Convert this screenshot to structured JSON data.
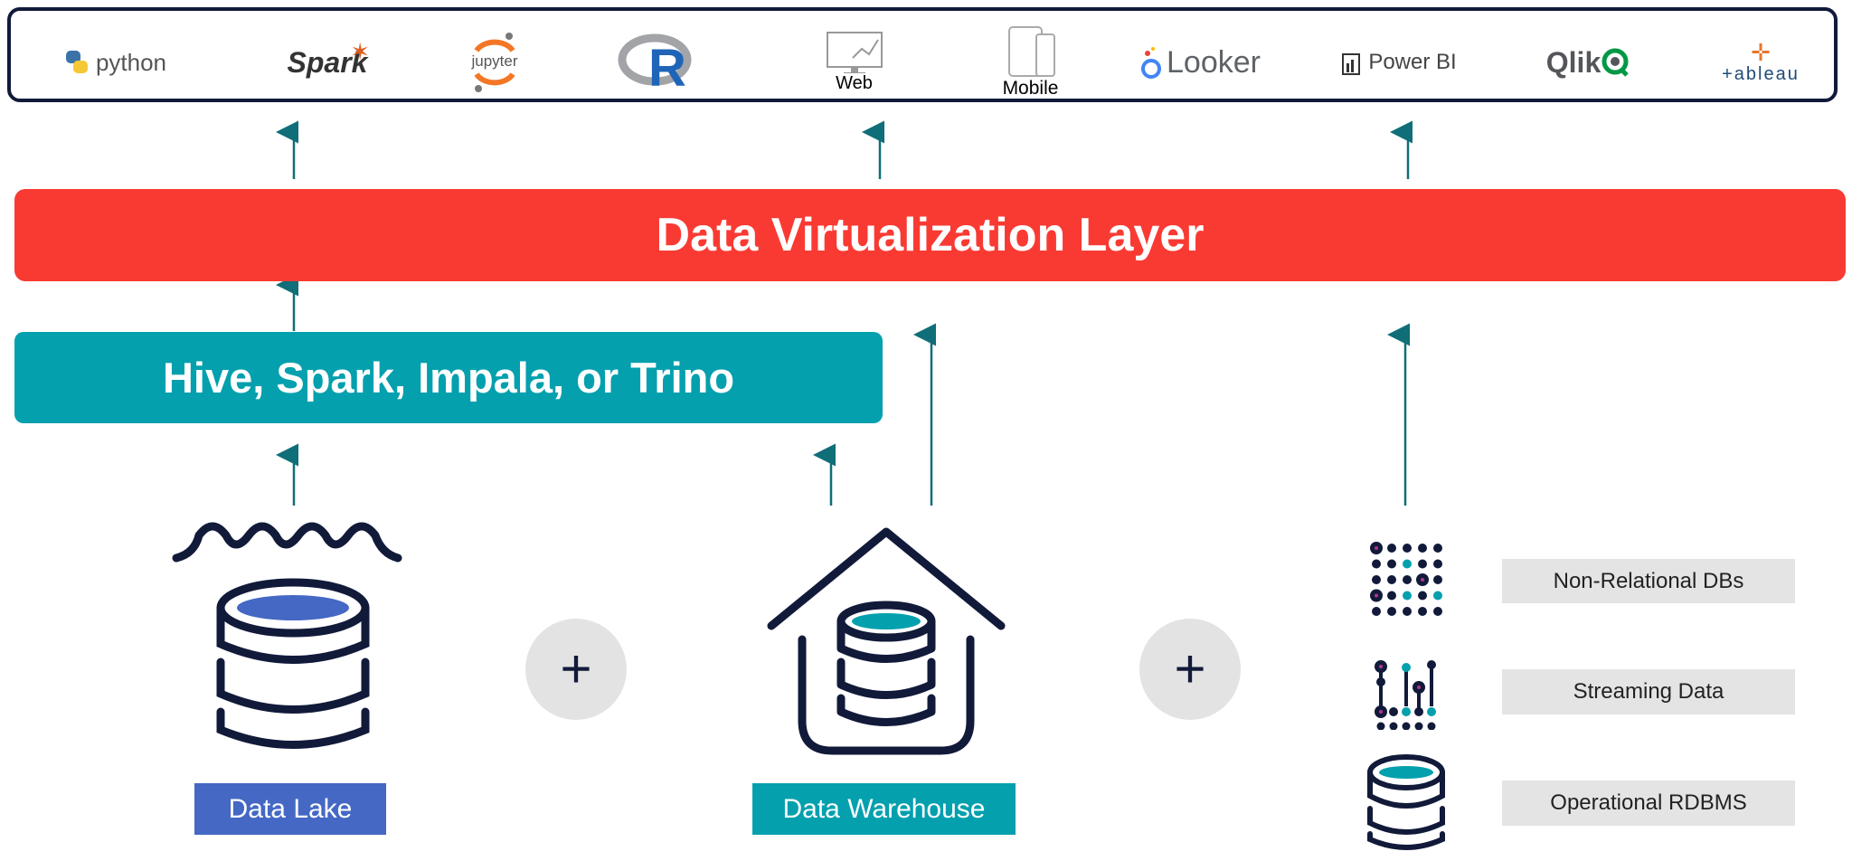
{
  "tools_bar": {
    "logos": [
      {
        "name": "python",
        "text": "python"
      },
      {
        "name": "spark",
        "text": "Spark"
      },
      {
        "name": "jupyter",
        "text": "jupyter"
      },
      {
        "name": "r",
        "text": "R"
      },
      {
        "name": "web",
        "text": "Web"
      },
      {
        "name": "mobile",
        "text": "Mobile"
      },
      {
        "name": "looker",
        "text": "Looker"
      },
      {
        "name": "power-bi",
        "text": "Power BI"
      },
      {
        "name": "qlik",
        "text": "Qlik"
      },
      {
        "name": "tableau",
        "text": "+ableau"
      }
    ]
  },
  "layers": {
    "virtualization": "Data Virtualization Layer",
    "engines": "Hive, Spark, Impala, or Trino"
  },
  "sources": {
    "data_lake": "Data Lake",
    "data_warehouse": "Data Warehouse",
    "plus": "+",
    "others": [
      "Non-Relational DBs",
      "Streaming Data",
      "Operational RDBMS"
    ]
  },
  "colors": {
    "red": "#f93a33",
    "teal": "#04a0ae",
    "lake_blue": "#4468c4",
    "navy": "#121a3a",
    "magenta": "#b0358f"
  }
}
